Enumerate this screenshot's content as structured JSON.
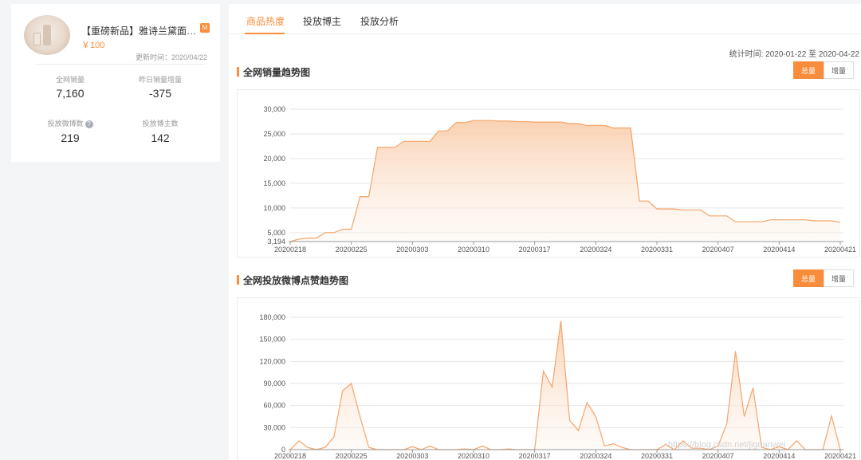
{
  "product": {
    "title": "【重磅新品】雅诗兰黛面部...",
    "platform_icon": "tmall-icon",
    "price": "￥100",
    "update_time": "更新时间：2020/04/22",
    "stats": [
      {
        "label": "全网销量",
        "value": "7,160"
      },
      {
        "label": "昨日销量增量",
        "value": "-375"
      },
      {
        "label": "投放微博数",
        "value": "219",
        "icon": "help-icon"
      },
      {
        "label": "投放博主数",
        "value": "142"
      }
    ]
  },
  "tabs": [
    {
      "label": "商品热度",
      "active": true
    },
    {
      "label": "投放博主",
      "active": false
    },
    {
      "label": "投放分析",
      "active": false
    }
  ],
  "stat_time": "统计时间: 2020-01-22 至 2020-04-22",
  "colors": {
    "accent": "#f98d3b",
    "line": "#f4a46a"
  },
  "sections": [
    {
      "title": "全网销量趋势图",
      "btn_total": "总量",
      "btn_increase": "增量"
    },
    {
      "title": "全网投放微博点赞趋势图",
      "btn_total": "总量",
      "btn_increase": "增量"
    }
  ],
  "watermark": "https://blog.csdn.net/jiguanwei",
  "chart_data": [
    {
      "type": "area",
      "title": "",
      "x_ticks": [
        "20200218",
        "20200225",
        "20200303",
        "20200310",
        "20200317",
        "20200324",
        "20200331",
        "20200407",
        "20200414",
        "20200421"
      ],
      "y_ticks": [
        "3,194",
        "5,000",
        "10,000",
        "15,000",
        "20,000",
        "25,000",
        "30,000"
      ],
      "ylim": [
        3194,
        30000
      ],
      "grid": true,
      "values": [
        3194,
        3700,
        3900,
        3900,
        5000,
        5000,
        5700,
        5700,
        12300,
        12300,
        22300,
        22300,
        22300,
        23500,
        23500,
        23500,
        23500,
        25600,
        25600,
        27300,
        27300,
        27700,
        27700,
        27700,
        27600,
        27600,
        27500,
        27500,
        27400,
        27400,
        27400,
        27400,
        27100,
        27100,
        26700,
        26700,
        26700,
        26200,
        26200,
        26200,
        11400,
        11400,
        9800,
        9800,
        9800,
        9600,
        9600,
        9600,
        8400,
        8400,
        8400,
        7200,
        7200,
        7200,
        7200,
        7600,
        7600,
        7600,
        7600,
        7600,
        7400,
        7400,
        7400,
        7100
      ]
    },
    {
      "type": "area",
      "title": "",
      "x_ticks": [
        "20200218",
        "20200225",
        "20200303",
        "20200310",
        "20200317",
        "20200324",
        "20200331",
        "20200407",
        "20200414",
        "20200421"
      ],
      "y_ticks": [
        "0",
        "30,000",
        "60,000",
        "90,000",
        "120,000",
        "150,000",
        "180,000"
      ],
      "ylim": [
        0,
        180000
      ],
      "grid": true,
      "values": [
        0,
        12000,
        3000,
        0,
        3000,
        17000,
        80000,
        90000,
        45000,
        3000,
        0,
        0,
        0,
        0,
        4000,
        0,
        5000,
        0,
        0,
        0,
        1000,
        0,
        5000,
        0,
        0,
        1000,
        0,
        0,
        0,
        107000,
        85000,
        175000,
        40000,
        26000,
        64000,
        45000,
        5000,
        8000,
        3000,
        0,
        0,
        0,
        0,
        7000,
        0,
        12000,
        2000,
        2000,
        0,
        5000,
        35000,
        134000,
        45000,
        84000,
        3000,
        0,
        4000,
        0,
        12000,
        0,
        0,
        0,
        46000,
        0
      ]
    }
  ]
}
